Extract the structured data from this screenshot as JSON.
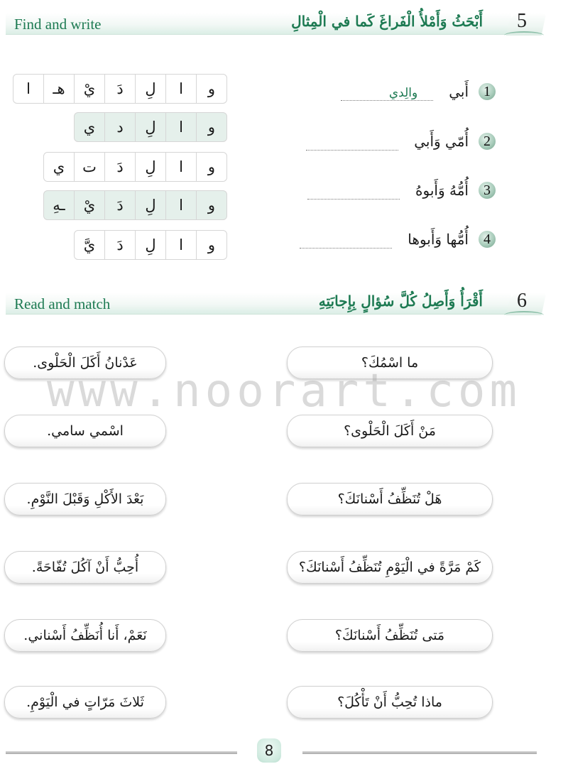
{
  "exercise5": {
    "number": "5",
    "title_en": "Find and write",
    "title_ar": "أَبْحَثُ وَأَمْلأُ الْفَراغَ كَما في الْمِثالِ",
    "letter_rows": [
      {
        "shaded": false,
        "letters": [
          "و",
          "ا",
          "لِ",
          "دَ",
          "يْ",
          "هـ",
          "ا"
        ]
      },
      {
        "shaded": true,
        "letters": [
          "و",
          "ا",
          "لِ",
          "د",
          "ي"
        ]
      },
      {
        "shaded": false,
        "letters": [
          "و",
          "ا",
          "لِ",
          "دَ",
          "ت",
          "ي"
        ]
      },
      {
        "shaded": true,
        "letters": [
          "و",
          "ا",
          "لِ",
          "دَ",
          "يْ",
          "ـهِ"
        ]
      },
      {
        "shaded": false,
        "letters": [
          "و",
          "ا",
          "لِ",
          "دَ",
          "يَّ"
        ]
      }
    ],
    "questions": [
      {
        "num": "1",
        "text": "أَبي",
        "answer": "والِدي"
      },
      {
        "num": "2",
        "text": "أُمّي وَأَبي",
        "answer": ""
      },
      {
        "num": "3",
        "text": "أُمُّهُ وَأَبوهُ",
        "answer": ""
      },
      {
        "num": "4",
        "text": "أُمُّها وَأَبوها",
        "answer": ""
      }
    ]
  },
  "exercise6": {
    "number": "6",
    "title_en": "Read and match",
    "title_ar": "أَقْرَأُ وَأَصِلُ كُلَّ سُؤالٍ بِإِجابَتِهِ",
    "questions": [
      "ما اسْمُكَ؟",
      "مَنْ أَكَلَ الْحَلْوى؟",
      "هَلْ تُنَظِّفُ أَسْنانَكَ؟",
      "كَمْ مَرَّةً في الْيَوْمِ تُنَظِّفُ أَسْنانَكَ؟",
      "مَتى تُنَظِّفُ أَسْنانَكَ؟",
      "ماذا تُحِبُّ أَنْ تَأْكُلَ؟"
    ],
    "answers": [
      "عَدْنانُ أَكَلَ الْحَلْوى.",
      "اسْمي سامي.",
      "بَعْدَ الأَكْلِ وَقَبْلَ النَّوْمِ.",
      "أُحِبُّ أَنْ آكُلَ تُفّاحَةً.",
      "نَعَمْ، أَنا أُنَظِّفُ أَسْناني.",
      "ثَلاثَ مَرّاتٍ في الْيَوْمِ."
    ]
  },
  "watermark": "www.noorart.com",
  "page_number": "8",
  "colors": {
    "accent_green": "#1d7a52",
    "shaded_cell": "#e5f0eb"
  }
}
